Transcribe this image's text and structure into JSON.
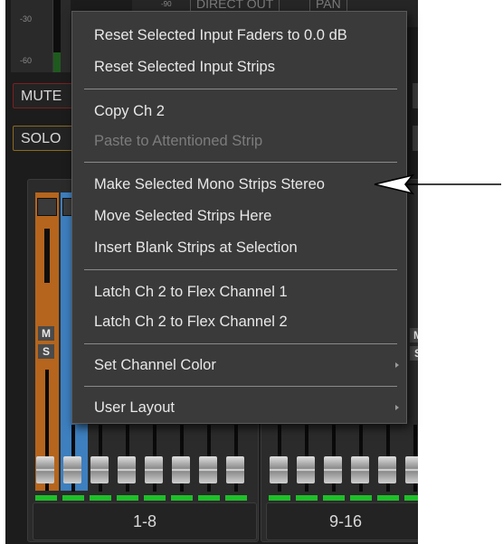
{
  "background": {
    "meter_labels": [
      "-30",
      "-60"
    ],
    "header_buttons": [
      "DIRECT OUT",
      "PAN"
    ],
    "header_marker": "-90",
    "mute_label": "MUTE",
    "solo_label": "SOLO",
    "strip_buttons": {
      "m": "M",
      "s": "S"
    },
    "banks": [
      {
        "label": "1-8"
      },
      {
        "label": "9-16"
      }
    ]
  },
  "menu": {
    "items": [
      {
        "label": "Reset Selected Input Faders to 0.0 dB",
        "enabled": true
      },
      {
        "label": "Reset Selected Input Strips",
        "enabled": true
      },
      {
        "label": "Copy Ch 2",
        "enabled": true
      },
      {
        "label": "Paste to Attentioned Strip",
        "enabled": false
      },
      {
        "label": "Make Selected Mono Strips Stereo",
        "enabled": true
      },
      {
        "label": "Move Selected Strips Here",
        "enabled": true
      },
      {
        "label": "Insert Blank Strips at Selection",
        "enabled": true
      },
      {
        "label": "Latch Ch 2 to Flex Channel 1",
        "enabled": true
      },
      {
        "label": "Latch Ch 2 to Flex Channel 2",
        "enabled": true
      },
      {
        "label": "Set Channel Color",
        "enabled": true,
        "submenu": true
      },
      {
        "label": "User Layout",
        "enabled": true,
        "submenu": true
      }
    ]
  },
  "colors": {
    "menu_bg": "#3a3a3a",
    "disabled_text": "#7c7c7c",
    "strip_orange": "#b5651d",
    "strip_blue": "#3d7fbf",
    "led_green": "#1fbf2a"
  },
  "icons": [
    "submenu-chevron-icon",
    "callout-arrow-icon"
  ]
}
